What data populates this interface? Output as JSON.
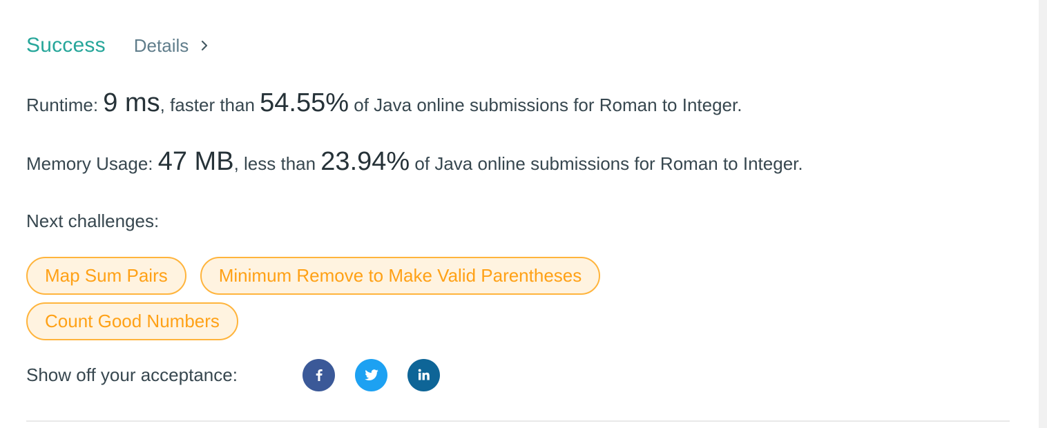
{
  "status": {
    "title": "Success",
    "details_label": "Details"
  },
  "runtime": {
    "label": "Runtime: ",
    "value": "9 ms",
    "comparison": ", faster than ",
    "percent": "54.55%",
    "suffix": " of Java online submissions for Roman to Integer."
  },
  "memory": {
    "label": "Memory Usage: ",
    "value": "47 MB",
    "comparison": ", less than ",
    "percent": "23.94%",
    "suffix": " of Java online submissions for Roman to Integer."
  },
  "next_challenges": {
    "label": "Next challenges:",
    "items": [
      "Map Sum Pairs",
      "Minimum Remove to Make Valid Parentheses",
      "Count Good Numbers"
    ]
  },
  "share": {
    "label": "Show off your acceptance:",
    "icons": [
      "facebook-icon",
      "twitter-icon",
      "linkedin-icon"
    ]
  },
  "colors": {
    "success": "#26a69a",
    "chip_text": "#ffa116",
    "chip_border": "#ffb43c",
    "chip_bg": "#fff3e0",
    "facebook": "#3b5998",
    "twitter": "#1da1f2",
    "linkedin": "#0e6597"
  }
}
